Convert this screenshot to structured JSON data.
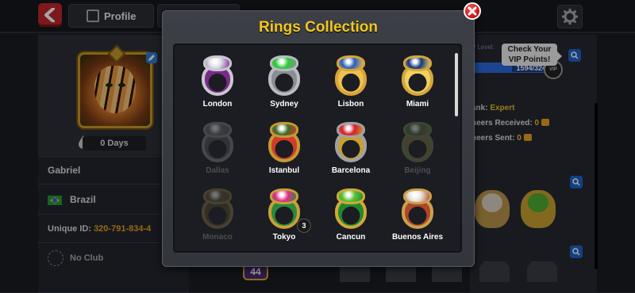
{
  "header": {
    "profile_tab": "Profile"
  },
  "profile": {
    "days": "0 Days",
    "name": "Gabriel",
    "country": "Brazil",
    "unique_id_label": "Unique ID:",
    "unique_id_value": "320-791-834-4",
    "club": "No Club",
    "level_badge": "44"
  },
  "vip": {
    "level_label": "P Level:",
    "progress_text": "1594/3240",
    "progress_fraction": 0.492,
    "ring_text": "VIP",
    "tooltip": "Check Your VIP Points!"
  },
  "stats": {
    "rank_label": "ank:",
    "rank_value": "Expert",
    "cheers_received_label": "heers Received:",
    "cheers_received_value": "0",
    "cheers_sent_label": "heers Sent:",
    "cheers_sent_value": "0"
  },
  "modal": {
    "title": "Rings Collection",
    "rings": [
      {
        "name": "London",
        "owned": true,
        "band": "#c8c8cc",
        "stone": "#d9d9e6",
        "accent": "#7a2b8a"
      },
      {
        "name": "Sydney",
        "owned": true,
        "band": "#b9bcc0",
        "stone": "#2ecb3a",
        "accent": "#8a8d92"
      },
      {
        "name": "Lisbon",
        "owned": true,
        "band": "#d8a43a",
        "stone": "#2a5fb8",
        "accent": "#f0c050"
      },
      {
        "name": "Miami",
        "owned": true,
        "band": "#d3a83c",
        "stone": "#18377a",
        "accent": "#f2d060"
      },
      {
        "name": "Dallas",
        "owned": false,
        "band": "#8a8d92",
        "stone": "#6b6e72",
        "accent": "#55585c"
      },
      {
        "name": "Istanbul",
        "owned": true,
        "band": "#c39a32",
        "stone": "#3f6b2a",
        "accent": "#d23a2a"
      },
      {
        "name": "Barcelona",
        "owned": true,
        "band": "#9ea2a8",
        "stone": "#d61e2a",
        "accent": "#c8a030"
      },
      {
        "name": "Beijing",
        "owned": false,
        "band": "#6f8a5a",
        "stone": "#4a6b3a",
        "accent": "#8a7a3a"
      },
      {
        "name": "Monaco",
        "owned": false,
        "band": "#8f7a48",
        "stone": "#6a5a38",
        "accent": "#5a4a2a"
      },
      {
        "name": "Tokyo",
        "owned": true,
        "band": "#c8a038",
        "stone": "#e0308a",
        "accent": "#2a8a3a",
        "count": "3"
      },
      {
        "name": "Cancun",
        "owned": true,
        "band": "#d4a838",
        "stone": "#5cc23a",
        "accent": "#1e8a2e"
      },
      {
        "name": "Buenos Aires",
        "owned": true,
        "band": "#c9a24a",
        "stone": "#e8e2d8",
        "accent": "#b0452a"
      }
    ]
  }
}
